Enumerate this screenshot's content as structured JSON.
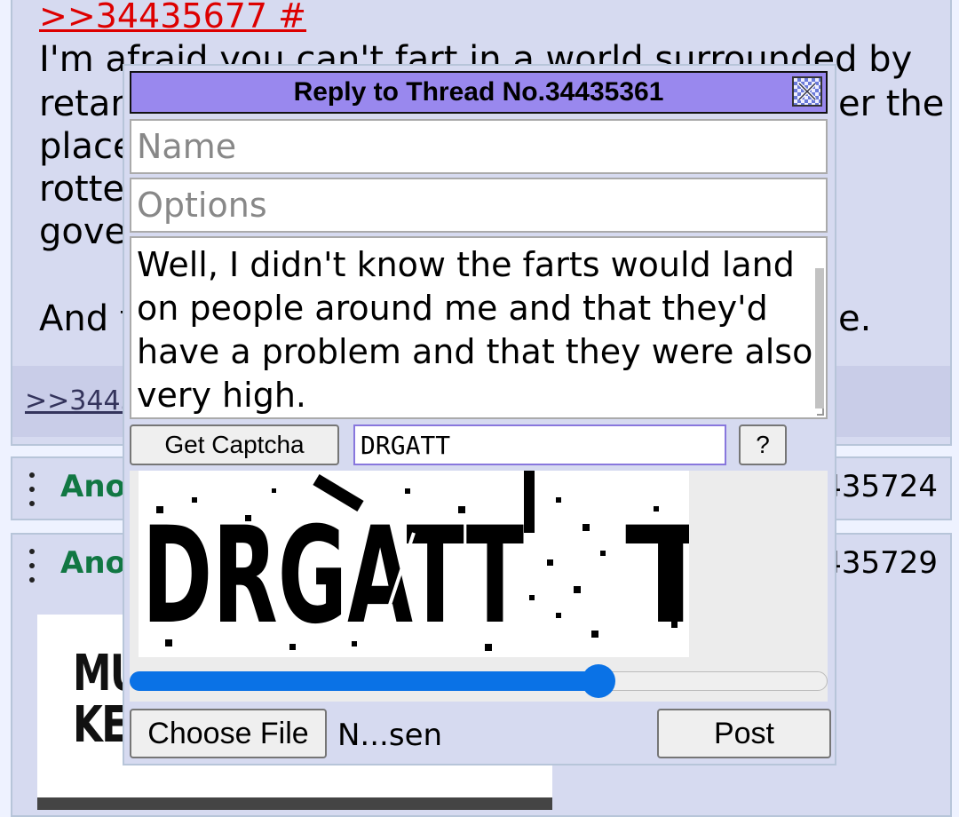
{
  "thread": {
    "quote_link": ">>34435677 #",
    "post_lines": [
      "I'm afraid you can't fart in a world surrounded by",
      "retarc",
      "place",
      "rotter",
      "gover",
      "And t"
    ],
    "right_fragments": [
      "er the",
      "e."
    ],
    "backlink": ">>34435"
  },
  "replies": [
    {
      "name": "Anon",
      "number_fragment": "435724"
    },
    {
      "name": "Anon",
      "number_fragment": "435729"
    }
  ],
  "thumbnail": {
    "line1": "MU",
    "line2": "KETO"
  },
  "dialog": {
    "title": "Reply to Thread No.34435361",
    "name_placeholder": "Name",
    "options_placeholder": "Options",
    "comment": "Well, I didn't know the farts would land on people around me and that they'd have a problem and that they were also very high.",
    "get_captcha_label": "Get Captcha",
    "captcha_value": "DRGATT",
    "captcha_help_label": "?",
    "captcha_slider_value": 0.68,
    "captcha_image_text": "DRGATT",
    "choose_file_label": "Choose File",
    "file_status": "N...sen",
    "post_label": "Post"
  },
  "colors": {
    "page_bg": "#eef2ff",
    "post_bg": "#d6daf0",
    "title_bar": "#9988ee",
    "quote_red": "#dd0000",
    "anon_green": "#117743",
    "slider_blue": "#0a72e6"
  }
}
